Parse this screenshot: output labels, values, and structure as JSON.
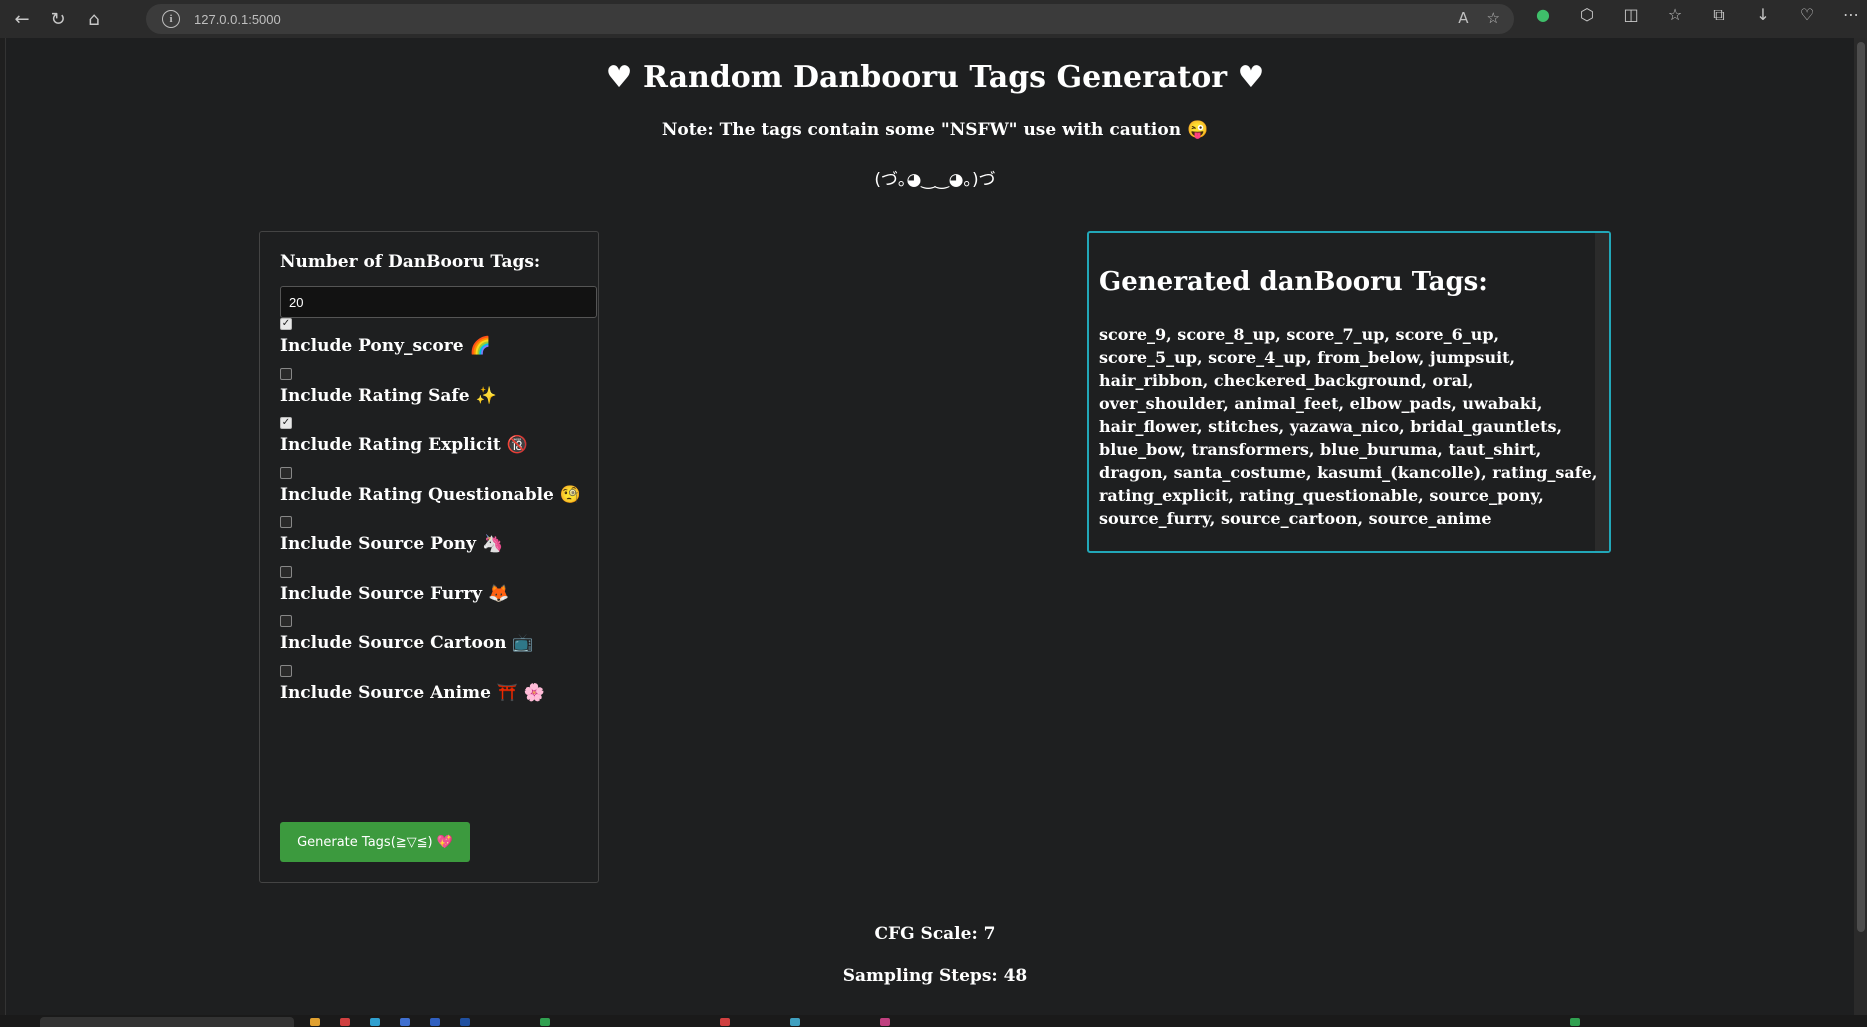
{
  "browser": {
    "url": "127.0.0.1:5000",
    "nav_icons": [
      "back-icon",
      "refresh-icon",
      "home-icon"
    ],
    "address_icons": [
      "read-aloud-icon",
      "favorite-star-icon"
    ],
    "toolbar_icons": [
      "copilot-icon",
      "extensions-icon",
      "split-screen-icon",
      "favorites-icon",
      "collections-icon",
      "downloads-icon",
      "health-icon",
      "more-icon"
    ]
  },
  "page": {
    "title": "♥ Random Danbooru Tags Generator ♥",
    "note": "Note: The tags contain some \"NSFW\" use with caution 😜",
    "kaomoji": "(づ｡◕‿‿◕｡)づ"
  },
  "form": {
    "count_label": "Number of DanBooru Tags:",
    "count_value": "20",
    "options": [
      {
        "label": "Include Pony_score 🌈",
        "checked": true
      },
      {
        "label": "Include Rating Safe ✨",
        "checked": false
      },
      {
        "label": "Include Rating Explicit 🔞",
        "checked": true
      },
      {
        "label": "Include Rating Questionable 🧐",
        "checked": false
      },
      {
        "label": "Include Source Pony 🦄",
        "checked": false
      },
      {
        "label": "Include Source Furry 🦊",
        "checked": false
      },
      {
        "label": "Include Source Cartoon 📺",
        "checked": false
      },
      {
        "label": "Include Source Anime ⛩️ 🌸",
        "checked": false
      }
    ],
    "generate_label": "Generate Tags(≧▽≦) 💖"
  },
  "output": {
    "heading": "Generated danBooru Tags:",
    "tags": "score_9, score_8_up, score_7_up, score_6_up, score_5_up, score_4_up, from_below, jumpsuit, hair_ribbon, checkered_background, oral, over_shoulder, animal_feet, elbow_pads, uwabaki, hair_flower, stitches, yazawa_nico, bridal_gauntlets, blue_bow, transformers, blue_buruma, taut_shirt, dragon, santa_costume, kasumi_(kancolle), rating_safe, rating_explicit, rating_questionable, source_pony, source_furry, source_cartoon, source_anime"
  },
  "footer": {
    "cfg": "CFG Scale: 7",
    "steps": "Sampling Steps: 48"
  },
  "colors": {
    "background": "#1e1f20",
    "accent_border": "#22a7b8",
    "button": "#3c9a3e"
  }
}
